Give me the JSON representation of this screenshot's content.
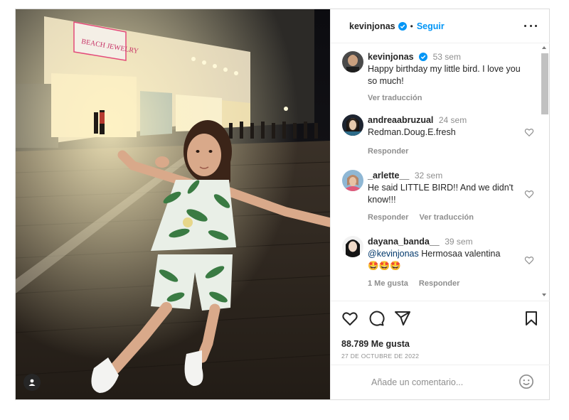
{
  "post": {
    "author": "kevinjonas",
    "follow_label": "Seguir",
    "separator": "•",
    "more_icon": "more-horizontal-icon",
    "verified_color": "#0095f6"
  },
  "caption": {
    "username": "kevinjonas",
    "time": "53 sem",
    "text": "Happy birthday my little bird. I love you so much!",
    "translate_label": "Ver traducción"
  },
  "comments": [
    {
      "username": "andreaabruzual",
      "time": "24 sem",
      "text": "Redman.Doug.E.fresh",
      "reply_label": "Responder"
    },
    {
      "username": "_arlette__",
      "time": "32 sem",
      "text": "He said LITTLE BIRD!! And we didn't know!!!",
      "reply_label": "Responder",
      "translate_label": "Ver traducción"
    },
    {
      "username": "dayana_banda__",
      "time": "39 sem",
      "mention": "@kevinjonas",
      "text": " Hermosaa valentina",
      "emojis": "🤩🤩🤩",
      "likes_label": "1 Me gusta",
      "reply_label": "Responder"
    }
  ],
  "actions": {
    "likes": "88.789 Me gusta",
    "date": "27 DE OCTUBRE DE 2022"
  },
  "comment_box": {
    "placeholder": "Añade un comentario..."
  },
  "colors": {
    "link_blue": "#0095f6",
    "muted": "#8e8e8e",
    "text": "#262626",
    "border": "#dbdbdb"
  }
}
